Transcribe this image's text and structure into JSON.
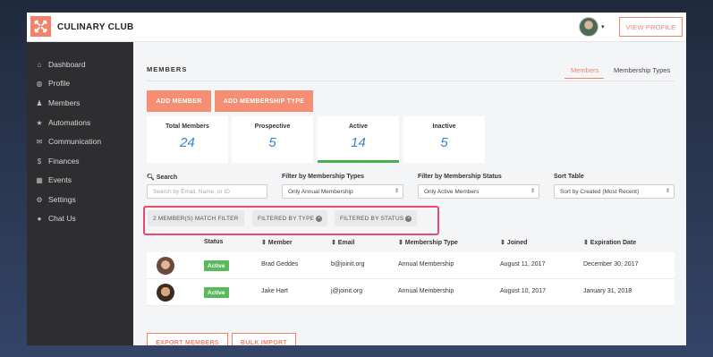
{
  "brand": {
    "name": "CULINARY CLUB",
    "logo_icon": "compass-logo-icon",
    "accent": "#f0836b"
  },
  "header": {
    "view_profile": "VIEW PROFILE",
    "caret": "▾"
  },
  "sidebar": {
    "items": [
      {
        "label": "Dashboard",
        "icon": "home-icon",
        "glyph": "⌂"
      },
      {
        "label": "Profile",
        "icon": "globe-icon",
        "glyph": "◍"
      },
      {
        "label": "Members",
        "icon": "user-icon",
        "glyph": "♟"
      },
      {
        "label": "Automations",
        "icon": "star-icon",
        "glyph": "★"
      },
      {
        "label": "Communication",
        "icon": "envelope-icon",
        "glyph": "✉"
      },
      {
        "label": "Finances",
        "icon": "dollar-icon",
        "glyph": "$"
      },
      {
        "label": "Events",
        "icon": "calendar-icon",
        "glyph": "▦"
      },
      {
        "label": "Settings",
        "icon": "gear-icon",
        "glyph": "⚙"
      },
      {
        "label": "Chat Us",
        "icon": "chat-icon",
        "glyph": "●"
      }
    ]
  },
  "main": {
    "title": "MEMBERS",
    "tabs": {
      "members": "Members",
      "types": "Membership Types"
    },
    "buttons": {
      "add_member": "ADD MEMBER",
      "add_type": "ADD MEMBERSHIP TYPE"
    },
    "cards": [
      {
        "label": "Total Members",
        "value": "24"
      },
      {
        "label": "Prospective",
        "value": "5"
      },
      {
        "label": "Active",
        "value": "14"
      },
      {
        "label": "Inactive",
        "value": "5"
      }
    ],
    "filters": {
      "search_label": "Search",
      "search_placeholder": "Search by Email, Name, or ID",
      "type_label": "Filter by Membership Types",
      "type_value": "Only Annual Membership",
      "status_label": "Filter by Membership Status",
      "status_value": "Only Active Members",
      "sort_label": "Sort Table",
      "sort_value": "Sort by Created (Most Recent)"
    },
    "chips": {
      "match": "2 MEMBER(S) MATCH FILTER",
      "by_type": "FILTERED BY TYPE",
      "by_status": "FILTERED BY STATUS",
      "x": "×"
    },
    "table": {
      "headers": [
        "Status",
        "⇕ Member",
        "⇕ Email",
        "⇕ Membership Type",
        "⇕ Joined",
        "⇕ Expiration Date"
      ],
      "rows": [
        {
          "status": "Active",
          "member": "Brad Geddes",
          "email": "b@joinit.org",
          "type": "Annual Membership",
          "joined": "August 11, 2017",
          "expires": "December 30, 2017"
        },
        {
          "status": "Active",
          "member": "Jake Hart",
          "email": "j@joinit.org",
          "type": "Annual Membership",
          "joined": "August 10, 2017",
          "expires": "January 31, 2018"
        }
      ]
    },
    "footer_buttons": {
      "export": "EXPORT MEMBERS",
      "bulk": "BULK IMPORT"
    }
  }
}
